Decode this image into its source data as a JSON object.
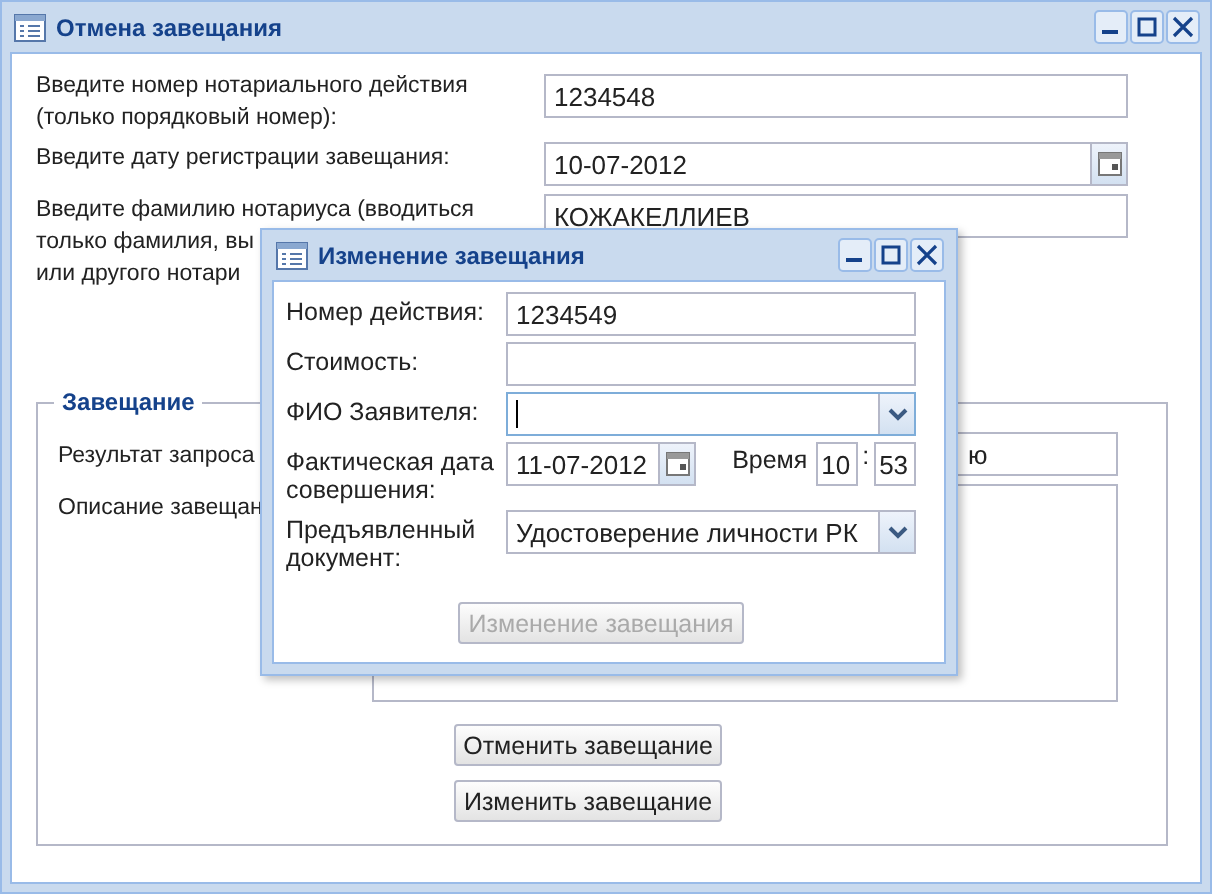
{
  "main_window": {
    "title": "Отмена завещания",
    "fields": [
      {
        "kind": "text",
        "label": [
          "Введите номер нотариального действия",
          "(только порядковый номер):"
        ],
        "value": "1234548"
      },
      {
        "kind": "date",
        "label": [
          "Введите дату регистрации завещания:"
        ],
        "value": "10-07-2012"
      },
      {
        "kind": "text",
        "label": [
          "Введите фамилию нотариуса (вводиться",
          "только фамилия, вы",
          "или другого нотари"
        ],
        "value": "КОЖАКЕЛЛИЕВ"
      }
    ],
    "group": {
      "legend": "Завещание",
      "result_label": "Результат запроса",
      "result_value": "ю",
      "description_label": "Описание завещан"
    },
    "buttons": [
      {
        "label": "Отменить завещание",
        "disabled": false
      },
      {
        "label": "Изменить завещание",
        "disabled": false
      }
    ]
  },
  "dialog": {
    "title": "Изменение завещания",
    "fields": [
      {
        "kind": "text",
        "label": "Номер действия:",
        "value": "1234549"
      },
      {
        "kind": "text",
        "label": "Стоимость:"
      },
      {
        "kind": "combo",
        "label": "ФИО Заявителя:",
        "focused": true
      },
      {
        "kind": "datetime",
        "label": "Фактическая дата совершения:",
        "value": "11-07-2012",
        "time_label": "Время",
        "hours": "10",
        "separator": ":",
        "minutes": "53"
      },
      {
        "kind": "combo",
        "label": "Предъявленный документ:",
        "value": "Удостоверение личности РК",
        "focused": false
      }
    ],
    "button": {
      "label": "Изменение завещания",
      "disabled": true
    }
  }
}
